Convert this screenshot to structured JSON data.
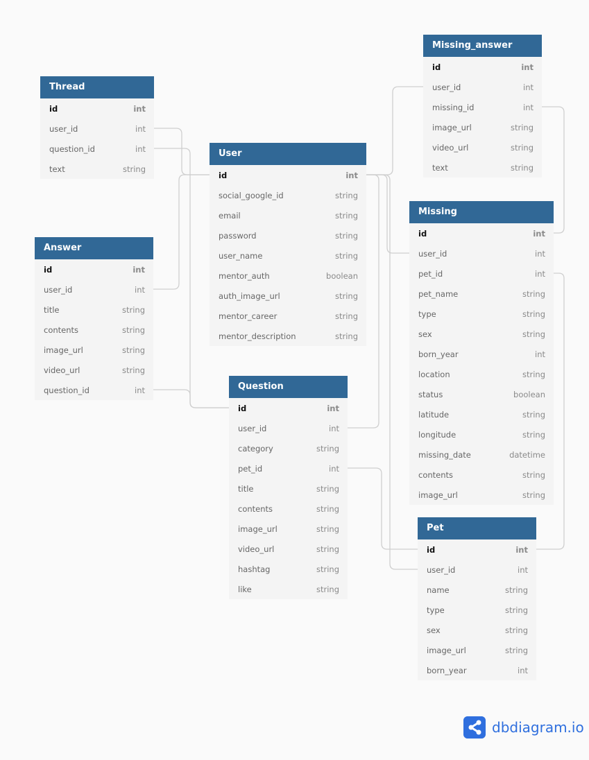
{
  "colors": {
    "header": "#316896",
    "link": "#cfcfcf",
    "brand": "#2f6fde"
  },
  "brand": {
    "name": "dbdiagram.io",
    "icon": "share-icon"
  },
  "tables": [
    {
      "name": "Thread",
      "fields": [
        [
          "id",
          "int"
        ],
        [
          "user_id",
          "int"
        ],
        [
          "question_id",
          "int"
        ],
        [
          "text",
          "string"
        ]
      ]
    },
    {
      "name": "User",
      "fields": [
        [
          "id",
          "int"
        ],
        [
          "social_google_id",
          "string"
        ],
        [
          "email",
          "string"
        ],
        [
          "password",
          "string"
        ],
        [
          "user_name",
          "string"
        ],
        [
          "mentor_auth",
          "boolean"
        ],
        [
          "auth_image_url",
          "string"
        ],
        [
          "mentor_career",
          "string"
        ],
        [
          "mentor_description",
          "string"
        ]
      ]
    },
    {
      "name": "Missing_answer",
      "fields": [
        [
          "id",
          "int"
        ],
        [
          "user_id",
          "int"
        ],
        [
          "missing_id",
          "int"
        ],
        [
          "image_url",
          "string"
        ],
        [
          "video_url",
          "string"
        ],
        [
          "text",
          "string"
        ]
      ]
    },
    {
      "name": "Answer",
      "fields": [
        [
          "id",
          "int"
        ],
        [
          "user_id",
          "int"
        ],
        [
          "title",
          "string"
        ],
        [
          "contents",
          "string"
        ],
        [
          "image_url",
          "string"
        ],
        [
          "video_url",
          "string"
        ],
        [
          "question_id",
          "int"
        ]
      ]
    },
    {
      "name": "Missing",
      "fields": [
        [
          "id",
          "int"
        ],
        [
          "user_id",
          "int"
        ],
        [
          "pet_id",
          "int"
        ],
        [
          "pet_name",
          "string"
        ],
        [
          "type",
          "string"
        ],
        [
          "sex",
          "string"
        ],
        [
          "born_year",
          "int"
        ],
        [
          "location",
          "string"
        ],
        [
          "status",
          "boolean"
        ],
        [
          "latitude",
          "string"
        ],
        [
          "longitude",
          "string"
        ],
        [
          "missing_date",
          "datetime"
        ],
        [
          "contents",
          "string"
        ],
        [
          "image_url",
          "string"
        ]
      ]
    },
    {
      "name": "Question",
      "fields": [
        [
          "id",
          "int"
        ],
        [
          "user_id",
          "int"
        ],
        [
          "category",
          "string"
        ],
        [
          "pet_id",
          "int"
        ],
        [
          "title",
          "string"
        ],
        [
          "contents",
          "string"
        ],
        [
          "image_url",
          "string"
        ],
        [
          "video_url",
          "string"
        ],
        [
          "hashtag",
          "string"
        ],
        [
          "like",
          "string"
        ]
      ]
    },
    {
      "name": "Pet",
      "fields": [
        [
          "id",
          "int"
        ],
        [
          "user_id",
          "int"
        ],
        [
          "name",
          "string"
        ],
        [
          "type",
          "string"
        ],
        [
          "sex",
          "string"
        ],
        [
          "image_url",
          "string"
        ],
        [
          "born_year",
          "int"
        ]
      ]
    }
  ],
  "relations": [
    [
      "Thread.user_id",
      "User.id"
    ],
    [
      "Thread.question_id",
      "Question.id"
    ],
    [
      "Answer.user_id",
      "User.id"
    ],
    [
      "Answer.question_id",
      "Question.id"
    ],
    [
      "Missing_answer.user_id",
      "User.id"
    ],
    [
      "Missing.user_id",
      "User.id"
    ],
    [
      "Question.user_id",
      "User.id"
    ],
    [
      "Pet.user_id",
      "User.id"
    ],
    [
      "Missing_answer.missing_id",
      "Missing.id"
    ],
    [
      "Missing.pet_id",
      "Pet.id"
    ],
    [
      "Question.pet_id",
      "Pet.id"
    ]
  ]
}
